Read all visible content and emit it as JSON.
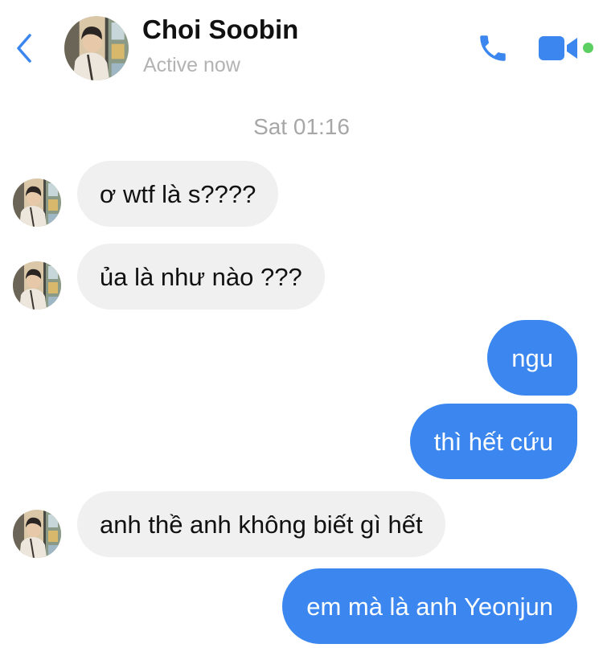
{
  "header": {
    "contact_name": "Choi Soobin",
    "status": "Active now",
    "icons": {
      "back": "chevron-left-icon",
      "call": "phone-icon",
      "video": "video-camera-icon"
    },
    "colors": {
      "accent": "#3b87ef",
      "online": "#5ccf63"
    }
  },
  "conversation": {
    "timestamp": "Sat 01:16",
    "messages": [
      {
        "direction": "incoming",
        "text": "ơ wtf là s????"
      },
      {
        "direction": "incoming",
        "text": "ủa là như nào ???"
      },
      {
        "direction": "outgoing",
        "text": "ngu"
      },
      {
        "direction": "outgoing",
        "text": "thì hết cứu"
      },
      {
        "direction": "incoming",
        "text": "anh thề anh không biết gì hết"
      },
      {
        "direction": "outgoing",
        "text": "em mà là anh Yeonjun"
      }
    ],
    "colors": {
      "incoming_bubble": "#f0f0f0",
      "outgoing_bubble": "#3b87ef"
    }
  }
}
